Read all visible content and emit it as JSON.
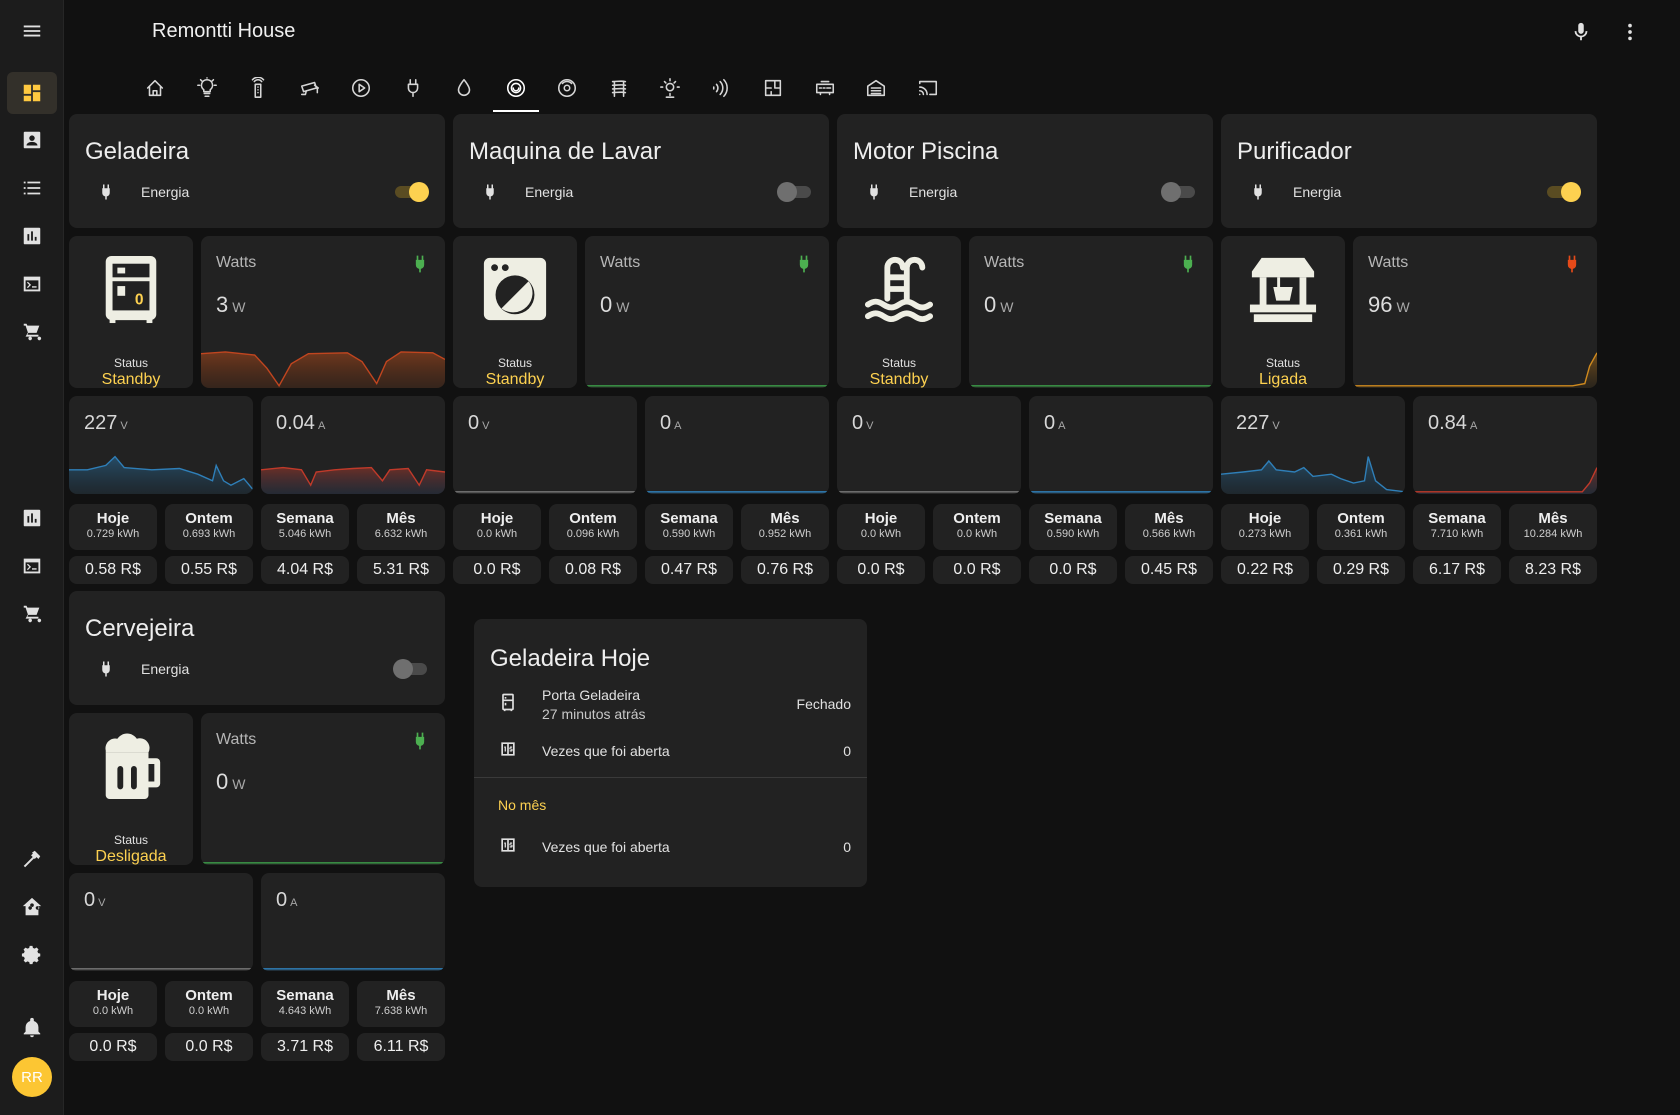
{
  "header": {
    "title": "Remontti House"
  },
  "sidebar": {
    "avatar_initials": "RR"
  },
  "view_tabs": [
    "home-icon",
    "lightbulb-icon",
    "remote-icon",
    "cctv-icon",
    "play-icon",
    "power-plug-icon",
    "water-drop-icon",
    "washing-machine-icon",
    "robot-vacuum-icon",
    "radiator-icon",
    "weather-icon",
    "wifi-signal-icon",
    "floor-plan-icon",
    "router-icon",
    "garage-icon",
    "cast-icon"
  ],
  "colors": {
    "accent": "#fdd150",
    "green": "#4caf50",
    "red": "#e64a19",
    "chart_blue": "#2f7fb8",
    "chart_orange": "#e0822a"
  },
  "devices": [
    {
      "name": "Geladeira",
      "entity": "Energia",
      "toggle": "on",
      "icon": "fridge-icon",
      "status_label": "Status",
      "status": "Standby",
      "watts_label": "Watts",
      "watts": "3",
      "watts_unit": "W",
      "plug_color": "green",
      "volts": "227",
      "volts_unit": "V",
      "amps": "0.04",
      "amps_unit": "A",
      "periods": [
        {
          "name": "Hoje",
          "kwh": "0.729 kWh",
          "cost": "0.58 R$"
        },
        {
          "name": "Ontem",
          "kwh": "0.693 kWh",
          "cost": "0.55 R$"
        },
        {
          "name": "Semana",
          "kwh": "5.046 kWh",
          "cost": "4.04 R$"
        },
        {
          "name": "Mês",
          "kwh": "6.632 kWh",
          "cost": "5.31 R$"
        }
      ]
    },
    {
      "name": "Maquina de Lavar",
      "entity": "Energia",
      "toggle": "off",
      "icon": "washing-machine-icon",
      "status_label": "Status",
      "status": "Standby",
      "watts_label": "Watts",
      "watts": "0",
      "watts_unit": "W",
      "plug_color": "green",
      "volts": "0",
      "volts_unit": "V",
      "amps": "0",
      "amps_unit": "A",
      "periods": [
        {
          "name": "Hoje",
          "kwh": "0.0 kWh",
          "cost": "0.0 R$"
        },
        {
          "name": "Ontem",
          "kwh": "0.096 kWh",
          "cost": "0.08 R$"
        },
        {
          "name": "Semana",
          "kwh": "0.590 kWh",
          "cost": "0.47 R$"
        },
        {
          "name": "Mês",
          "kwh": "0.952 kWh",
          "cost": "0.76 R$"
        }
      ]
    },
    {
      "name": "Motor Piscina",
      "entity": "Energia",
      "toggle": "off",
      "icon": "pool-icon",
      "status_label": "Status",
      "status": "Standby",
      "watts_label": "Watts",
      "watts": "0",
      "watts_unit": "W",
      "plug_color": "green",
      "volts": "0",
      "volts_unit": "V",
      "amps": "0",
      "amps_unit": "A",
      "periods": [
        {
          "name": "Hoje",
          "kwh": "0.0 kWh",
          "cost": "0.0 R$"
        },
        {
          "name": "Ontem",
          "kwh": "0.0 kWh",
          "cost": "0.0 R$"
        },
        {
          "name": "Semana",
          "kwh": "0.590 kWh",
          "cost": "0.0 R$"
        },
        {
          "name": "Mês",
          "kwh": "0.566 kWh",
          "cost": "0.45 R$"
        }
      ]
    },
    {
      "name": "Purificador",
      "entity": "Energia",
      "toggle": "on",
      "icon": "water-well-icon",
      "status_label": "Status",
      "status": "Ligada",
      "watts_label": "Watts",
      "watts": "96",
      "watts_unit": "W",
      "plug_color": "red",
      "volts": "227",
      "volts_unit": "V",
      "amps": "0.84",
      "amps_unit": "A",
      "periods": [
        {
          "name": "Hoje",
          "kwh": "0.273 kWh",
          "cost": "0.22 R$"
        },
        {
          "name": "Ontem",
          "kwh": "0.361 kWh",
          "cost": "0.29 R$"
        },
        {
          "name": "Semana",
          "kwh": "7.710 kWh",
          "cost": "6.17 R$"
        },
        {
          "name": "Mês",
          "kwh": "10.284 kWh",
          "cost": "8.23 R$"
        }
      ]
    },
    {
      "name": "Cervejeira",
      "entity": "Energia",
      "toggle": "off",
      "icon": "beer-mug-icon",
      "status_label": "Status",
      "status": "Desligada",
      "watts_label": "Watts",
      "watts": "0",
      "watts_unit": "W",
      "plug_color": "green",
      "volts": "0",
      "volts_unit": "V",
      "amps": "0",
      "amps_unit": "A",
      "periods": [
        {
          "name": "Hoje",
          "kwh": "0.0 kWh",
          "cost": "0.0 R$"
        },
        {
          "name": "Ontem",
          "kwh": "0.0 kWh",
          "cost": "0.0 R$"
        },
        {
          "name": "Semana",
          "kwh": "4.643 kWh",
          "cost": "3.71 R$"
        },
        {
          "name": "Mês",
          "kwh": "7.638 kWh",
          "cost": "6.11 R$"
        }
      ]
    }
  ],
  "geladeira_hoje": {
    "title": "Geladeira Hoje",
    "door_label": "Porta Geladeira",
    "door_time": "27 minutos atrás",
    "door_state": "Fechado",
    "opens_label": "Vezes que foi aberta",
    "opens_today": "0",
    "month_section": "No mês",
    "opens_month_label": "Vezes que foi aberta",
    "opens_month": "0"
  }
}
